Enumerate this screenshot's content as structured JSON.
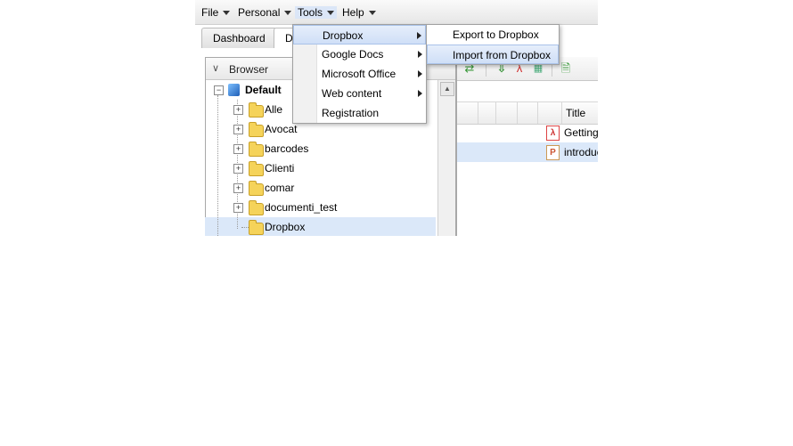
{
  "menubar": {
    "items": [
      {
        "label": "File",
        "has_arrow": true
      },
      {
        "label": "Personal",
        "has_arrow": true
      },
      {
        "label": "Tools",
        "has_arrow": true
      },
      {
        "label": "Help",
        "has_arrow": true
      }
    ]
  },
  "tabs": [
    {
      "label": "Dashboard"
    },
    {
      "label": "Do"
    }
  ],
  "browser": {
    "title": "Browser",
    "root": {
      "label": "Default",
      "icon": "workspace-cube-icon"
    },
    "folders": [
      {
        "label": "Alle"
      },
      {
        "label": "Avocat"
      },
      {
        "label": "barcodes"
      },
      {
        "label": "Clienti"
      },
      {
        "label": "comar"
      },
      {
        "label": "documenti_test"
      },
      {
        "label": "Dropbox",
        "selected": true
      }
    ]
  },
  "documents": {
    "toolbar_icons": [
      "refresh-icon",
      "download-icon",
      "pdf-icon",
      "office-icon",
      "add-document-icon"
    ],
    "columns": {
      "title": "Title"
    },
    "rows": [
      {
        "title": "Getting",
        "icon": "pdf-icon"
      },
      {
        "title": "introduc",
        "icon": "ppt-icon",
        "selected": true
      }
    ]
  },
  "tools_menu": {
    "items": [
      {
        "label": "Dropbox",
        "submenu": true,
        "highlighted": true
      },
      {
        "label": "Google Docs",
        "submenu": true
      },
      {
        "label": "Microsoft Office",
        "submenu": true
      },
      {
        "label": "Web content",
        "submenu": true
      },
      {
        "label": "Registration",
        "submenu": false
      }
    ]
  },
  "dropbox_submenu": {
    "items": [
      {
        "label": "Export to Dropbox"
      },
      {
        "label": "Import from Dropbox",
        "highlighted": true
      }
    ]
  },
  "colors": {
    "selection": "#dbe8f9",
    "menu_highlight": "#cfdff7",
    "folder": "#f5d35a"
  }
}
